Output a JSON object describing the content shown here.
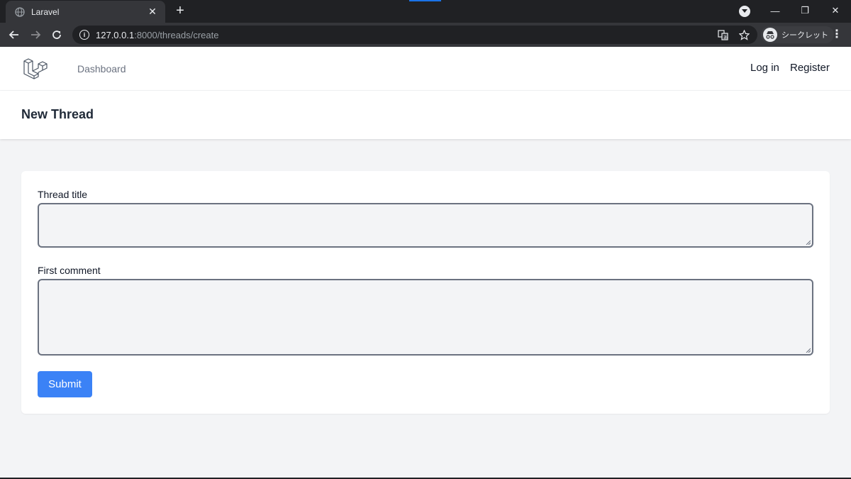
{
  "browser": {
    "tab": {
      "title": "Laravel",
      "close": "✕"
    },
    "new_tab": "+",
    "window": {
      "minimize": "—",
      "restore": "❐",
      "close": "✕"
    },
    "url": {
      "host": "127.0.0.1",
      "path": ":8000/threads/create"
    },
    "incognito_label": "シークレット",
    "menu": "⋮"
  },
  "nav": {
    "dashboard": "Dashboard",
    "login": "Log in",
    "register": "Register"
  },
  "header": {
    "title": "New Thread"
  },
  "form": {
    "title_label": "Thread title",
    "title_value": "",
    "comment_label": "First comment",
    "comment_value": "",
    "submit_label": "Submit"
  },
  "colors": {
    "accent": "#3b82f6",
    "page_bg": "#f3f4f6",
    "chrome_dark": "#202124"
  }
}
